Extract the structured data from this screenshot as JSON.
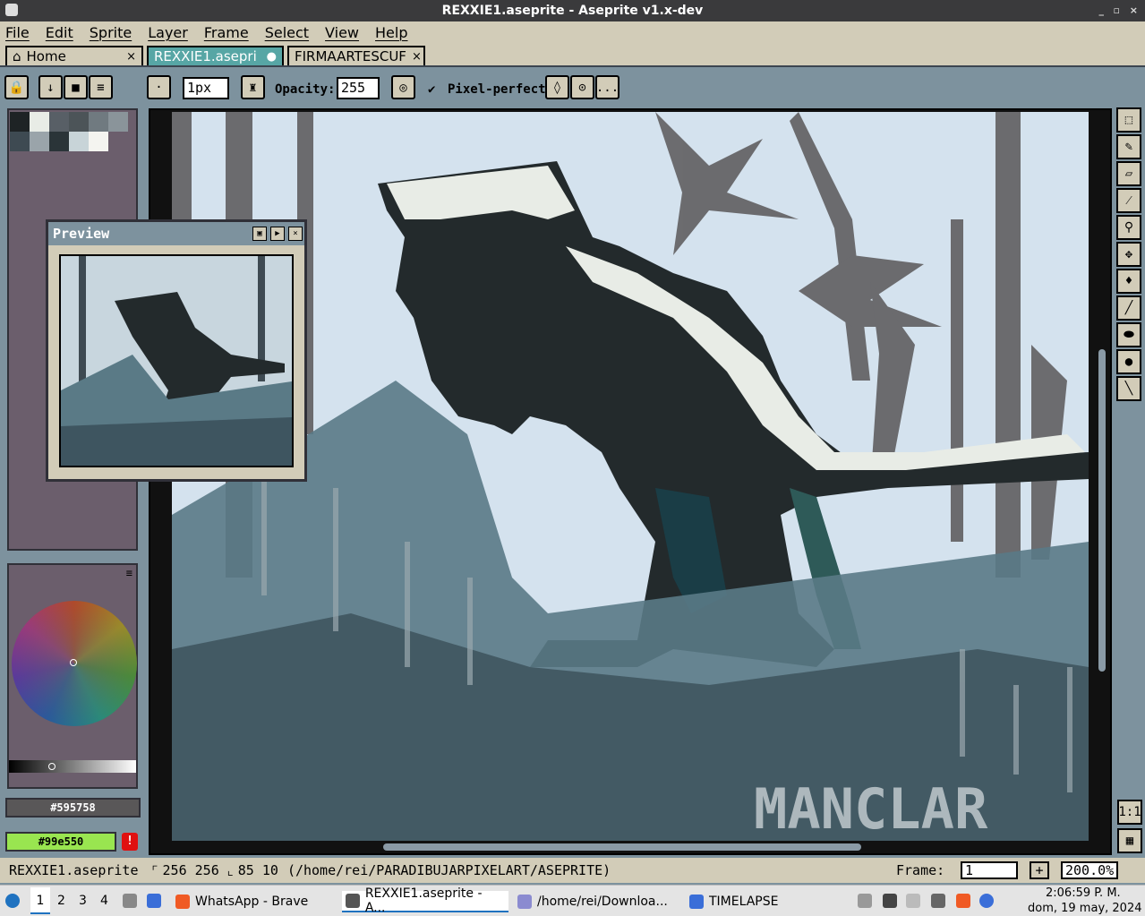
{
  "window": {
    "title": "REXXIE1.aseprite - Aseprite v1.x-dev",
    "controls": [
      "_",
      "▫",
      "×"
    ]
  },
  "menu": [
    "File",
    "Edit",
    "Sprite",
    "Layer",
    "Frame",
    "Select",
    "View",
    "Help"
  ],
  "tabs": [
    {
      "label": "Home",
      "close": "×"
    },
    {
      "label": "REXXIE1.asepri",
      "close": "●"
    },
    {
      "label": "FIRMAARTESCUF",
      "close": "×"
    }
  ],
  "toolbar": {
    "brush_size": "1px",
    "opacity_label": "Opacity:",
    "opacity_value": "255",
    "pixel_perfect_label": "Pixel-perfect",
    "more": "..."
  },
  "palette": {
    "swatches": [
      "#1e2325",
      "#e8ece6",
      "#585f66",
      "#4c5458",
      "#707a80",
      "#8a949a",
      "#3e4a52",
      "#9aa4aa",
      "#2a3438",
      "#c8d4d8",
      "#f4f4f0"
    ]
  },
  "preview": {
    "title": "Preview"
  },
  "colors": {
    "foreground": "#595758",
    "background": "#99e550",
    "accent": "#57a6a5",
    "warn_icon": "!"
  },
  "status": {
    "filename": "REXXIE1.aseprite",
    "size": "256 256",
    "pos": "85 10",
    "path": "(/home/rei/PARADIBUJARPIXELART/ASEPRITE)",
    "frame_label": "Frame:",
    "frame_value": "1",
    "add_frame": "+",
    "zoom": "200.0%"
  },
  "taskbar": {
    "workspaces": [
      "1",
      "2",
      "3",
      "4"
    ],
    "tasks": [
      "WhatsApp - Brave",
      "REXXIE1.aseprite - A...",
      "/home/rei/Downloa...",
      "TIMELAPSE"
    ],
    "time": "2:06:59 P. M.",
    "date": "dom, 19 may, 2024"
  },
  "art": {
    "watermark": "MANCLAR"
  }
}
